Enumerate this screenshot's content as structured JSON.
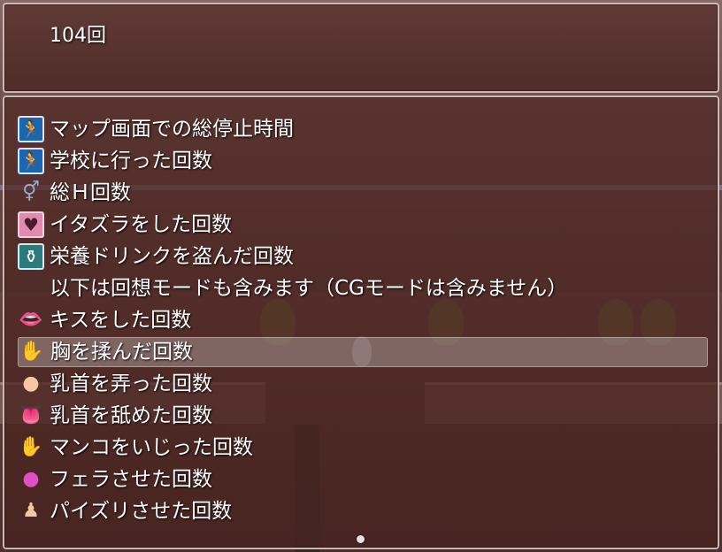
{
  "header": {
    "count": "104回"
  },
  "records": [
    {
      "icon": "running-person-icon",
      "glyph": "🏃",
      "style": "blue",
      "label": "マップ画面での総停止時間"
    },
    {
      "icon": "running-person-icon",
      "glyph": "🏃",
      "style": "blue",
      "label": "学校に行った回数"
    },
    {
      "icon": "male-female-symbol-icon",
      "glyph": "⚥",
      "style": "gear",
      "label": "総Ｈ回数"
    },
    {
      "icon": "hearts-icon",
      "glyph": "♥",
      "style": "pink",
      "label": "イタズラをした回数"
    },
    {
      "icon": "potion-bottle-icon",
      "glyph": "⚱",
      "style": "teal",
      "label": "栄養ドリンクを盗んだ回数"
    },
    {
      "icon": "",
      "glyph": "",
      "style": "none",
      "label": "以下は回想モードも含みます（CGモードは含みません）"
    },
    {
      "icon": "lips-icon",
      "glyph": "👄",
      "style": "red",
      "label": "キスをした回数"
    },
    {
      "icon": "chest-grab-icon",
      "glyph": "✋",
      "style": "flesh",
      "label": "胸を揉んだ回数"
    },
    {
      "icon": "chest-icon",
      "glyph": "●",
      "style": "flesh",
      "label": "乳首を弄った回数"
    },
    {
      "icon": "tongue-icon",
      "glyph": "👅",
      "style": "tongue",
      "label": "乳首を舐めた回数"
    },
    {
      "icon": "hand-icon",
      "glyph": "✋",
      "style": "flesh",
      "label": "マンコをいじった回数"
    },
    {
      "icon": "mouth-icon",
      "glyph": "●",
      "style": "magenta",
      "label": "フェラさせた回数"
    },
    {
      "icon": "body-icon",
      "glyph": "♟",
      "style": "flesh",
      "label": "パイズリさせた回数"
    }
  ],
  "selected_index": 7
}
